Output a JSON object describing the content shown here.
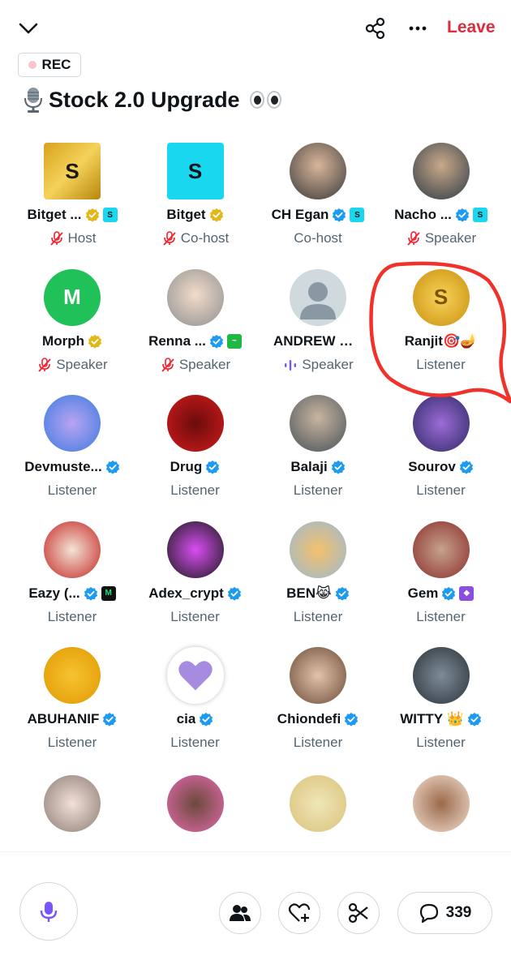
{
  "header": {
    "leave_label": "Leave",
    "rec_label": "REC",
    "title": "Stock 2.0 Upgrade"
  },
  "colors": {
    "leave": "#dc2d3e",
    "verified": "#1d9bf0",
    "gold_verified": "#e2b719",
    "muted_mic": "#f4212e",
    "speaking": "#7856ff",
    "highlight_circle": "#f0322a"
  },
  "participants": [
    {
      "name": "Bitget ...",
      "role": "Host",
      "verified": "gold",
      "extra_badge": "bitget-logo",
      "role_icon": "mic-muted-icon"
    },
    {
      "name": "Bitget",
      "role": "Co-host",
      "verified": "gold",
      "role_icon": "mic-muted-icon"
    },
    {
      "name": "CH Egan",
      "role": "Co-host",
      "verified": "blue",
      "extra_badge": "bitget-logo"
    },
    {
      "name": "Nacho ...",
      "role": "Speaker",
      "verified": "blue",
      "extra_badge": "bitget-logo",
      "role_icon": "mic-muted-icon"
    },
    {
      "name": "Morph",
      "role": "Speaker",
      "verified": "gold",
      "role_icon": "mic-muted-icon"
    },
    {
      "name": "Renna ...",
      "role": "Speaker",
      "verified": "blue",
      "extra_badge": "green-chart-logo",
      "role_icon": "mic-muted-icon"
    },
    {
      "name": "ANDREW DEA...",
      "role": "Speaker",
      "role_icon": "speaking-wave-icon"
    },
    {
      "name": "Ranjit🎯🪔",
      "role": "Listener"
    },
    {
      "name": "Devmuste...",
      "role": "Listener",
      "verified": "blue"
    },
    {
      "name": "Drug",
      "role": "Listener",
      "verified": "blue"
    },
    {
      "name": "Balaji",
      "role": "Listener",
      "verified": "blue"
    },
    {
      "name": "Sourov",
      "role": "Listener",
      "verified": "blue"
    },
    {
      "name": "Eazy (...",
      "role": "Listener",
      "verified": "blue",
      "extra_badge": "mode-logo"
    },
    {
      "name": "Adex_crypt",
      "role": "Listener",
      "verified": "blue"
    },
    {
      "name": "BEN😹",
      "role": "Listener",
      "verified": "blue"
    },
    {
      "name": "Gem",
      "role": "Listener",
      "verified": "blue",
      "extra_badge": "gem-logo"
    },
    {
      "name": "ABUHANIF",
      "role": "Listener",
      "verified": "blue"
    },
    {
      "name": "cia",
      "role": "Listener",
      "verified": "blue"
    },
    {
      "name": "Chiondefi",
      "role": "Listener",
      "verified": "blue"
    },
    {
      "name": "WITTY 👑",
      "role": "Listener",
      "verified": "blue"
    }
  ],
  "footer": {
    "comment_count": "339"
  }
}
